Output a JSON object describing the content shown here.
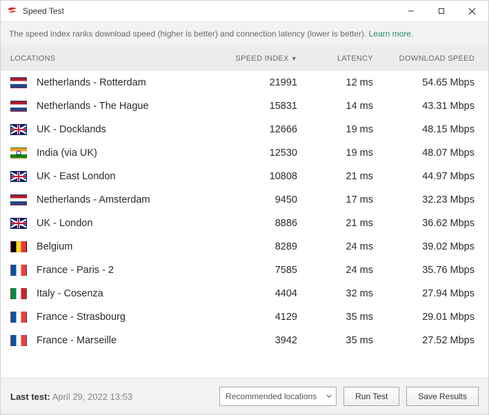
{
  "window": {
    "title": "Speed Test"
  },
  "info": {
    "text": "The speed index ranks download speed (higher is better) and connection latency (lower is better). ",
    "link": "Learn more."
  },
  "headers": {
    "locations": "LOCATIONS",
    "speed_index": "SPEED INDEX",
    "latency": "LATENCY",
    "download": "DOWNLOAD SPEED"
  },
  "rows": [
    {
      "flag": "nl",
      "location": "Netherlands - Rotterdam",
      "speed_index": "21991",
      "latency": "12 ms",
      "download": "54.65 Mbps"
    },
    {
      "flag": "nl",
      "location": "Netherlands - The Hague",
      "speed_index": "15831",
      "latency": "14 ms",
      "download": "43.31 Mbps"
    },
    {
      "flag": "uk",
      "location": "UK - Docklands",
      "speed_index": "12666",
      "latency": "19 ms",
      "download": "48.15 Mbps"
    },
    {
      "flag": "in",
      "location": "India (via UK)",
      "speed_index": "12530",
      "latency": "19 ms",
      "download": "48.07 Mbps"
    },
    {
      "flag": "uk",
      "location": "UK - East London",
      "speed_index": "10808",
      "latency": "21 ms",
      "download": "44.97 Mbps"
    },
    {
      "flag": "nl",
      "location": "Netherlands - Amsterdam",
      "speed_index": "9450",
      "latency": "17 ms",
      "download": "32.23 Mbps"
    },
    {
      "flag": "uk",
      "location": "UK - London",
      "speed_index": "8886",
      "latency": "21 ms",
      "download": "36.62 Mbps"
    },
    {
      "flag": "be",
      "location": "Belgium",
      "speed_index": "8289",
      "latency": "24 ms",
      "download": "39.02 Mbps"
    },
    {
      "flag": "fr",
      "location": "France - Paris - 2",
      "speed_index": "7585",
      "latency": "24 ms",
      "download": "35.76 Mbps"
    },
    {
      "flag": "it",
      "location": "Italy - Cosenza",
      "speed_index": "4404",
      "latency": "32 ms",
      "download": "27.94 Mbps"
    },
    {
      "flag": "fr",
      "location": "France - Strasbourg",
      "speed_index": "4129",
      "latency": "35 ms",
      "download": "29.01 Mbps"
    },
    {
      "flag": "fr",
      "location": "France - Marseille",
      "speed_index": "3942",
      "latency": "35 ms",
      "download": "27.52 Mbps"
    }
  ],
  "footer": {
    "last_test_label": "Last test:",
    "last_test_value": "April 29, 2022 13:53",
    "select_value": "Recommended locations",
    "run_test": "Run Test",
    "save_results": "Save Results"
  }
}
